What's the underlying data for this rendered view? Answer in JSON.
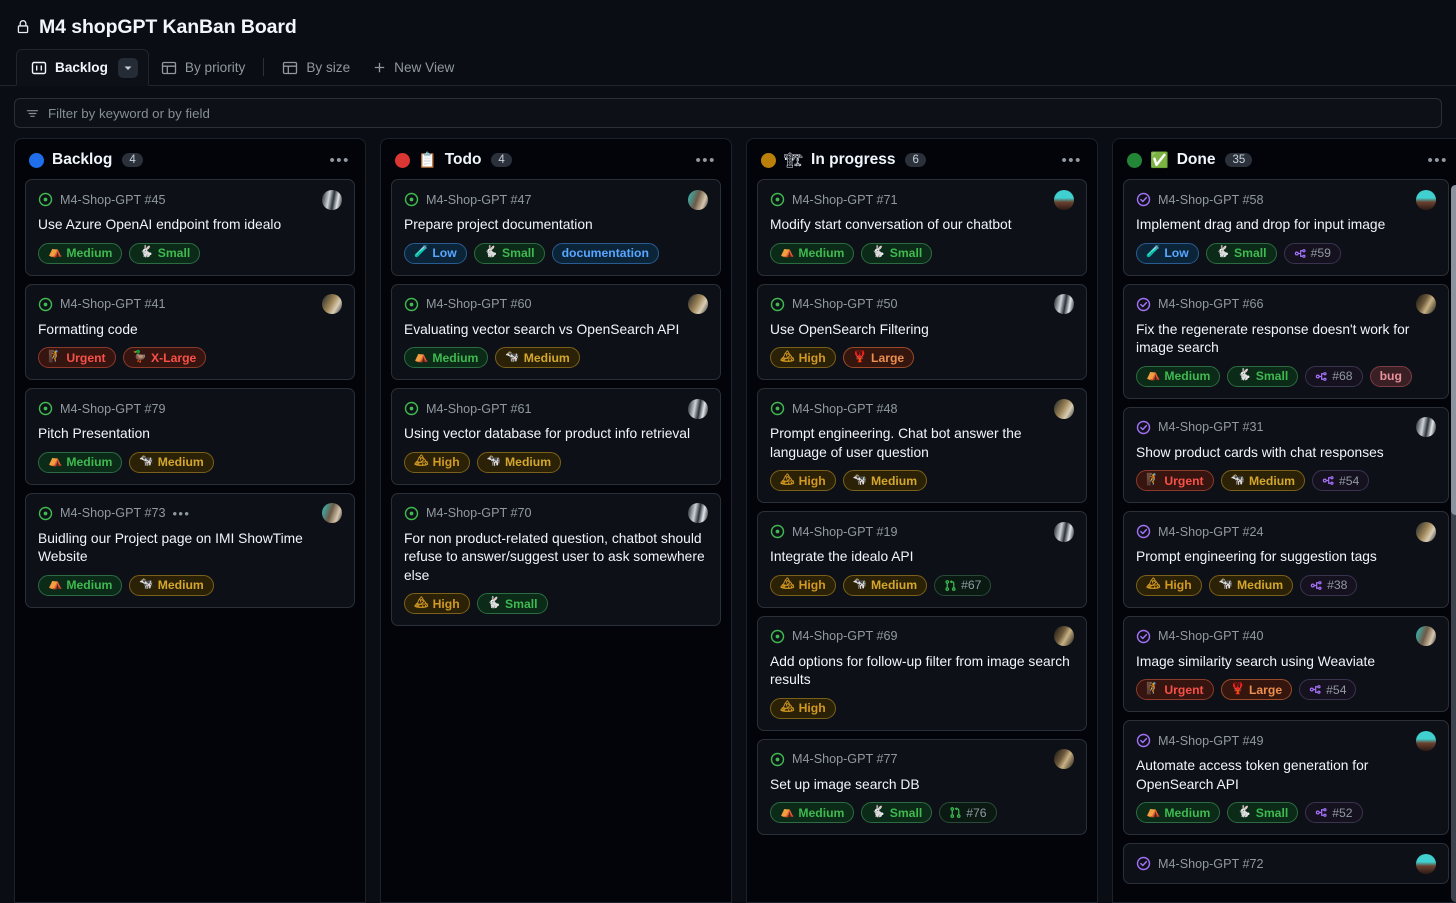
{
  "header": {
    "lock_icon": "lock-icon",
    "title": "M4 shopGPT KanBan Board"
  },
  "tabs": {
    "active": {
      "label": "Backlog",
      "icon": "board-view-icon",
      "caret_icon": "chevron-down-icon"
    },
    "items": [
      {
        "label": "By priority",
        "icon": "table-view-icon"
      },
      {
        "label": "By size",
        "icon": "table-view-icon"
      }
    ],
    "new_view": {
      "label": "New View",
      "icon": "plus-icon"
    }
  },
  "filter": {
    "icon": "filter-icon",
    "placeholder": "Filter by keyword or by field",
    "value": ""
  },
  "columns": [
    {
      "name": "Backlog",
      "dot_color": "#1f6feb",
      "emoji": "",
      "count": "4",
      "more_icon": "column-more-icon",
      "scrollbar": false,
      "cards": [
        {
          "ref": "M4-Shop-GPT #45",
          "status_icon": "open-issue-icon",
          "title": "Use Azure OpenAI endpoint from idealo",
          "avatar": "avatar-stripe",
          "inline_more": "",
          "pills": [
            {
              "emoji": "⛺",
              "text": "Medium",
              "style": "green"
            },
            {
              "emoji": "🐇",
              "text": "Small",
              "style": "green"
            }
          ]
        },
        {
          "ref": "M4-Shop-GPT #41",
          "status_icon": "open-issue-icon",
          "title": "Formatting code",
          "avatar": "avatar-gold",
          "inline_more": "",
          "pills": [
            {
              "emoji": "🧗",
              "text": "Urgent",
              "style": "red"
            },
            {
              "emoji": "🦆",
              "text": "X-Large",
              "style": "red"
            }
          ]
        },
        {
          "ref": "M4-Shop-GPT #79",
          "status_icon": "open-issue-icon",
          "title": "Pitch Presentation",
          "avatar": "",
          "inline_more": "",
          "pills": [
            {
              "emoji": "⛺",
              "text": "Medium",
              "style": "green"
            },
            {
              "emoji": "🐄",
              "text": "Medium",
              "style": "gold"
            }
          ]
        },
        {
          "ref": "M4-Shop-GPT #73",
          "status_icon": "open-issue-icon",
          "title": "Buidling our Project page on IMI ShowTime Website",
          "avatar": "avatar-teal",
          "inline_more": "•••",
          "pills": [
            {
              "emoji": "⛺",
              "text": "Medium",
              "style": "green"
            },
            {
              "emoji": "🐄",
              "text": "Medium",
              "style": "gold"
            }
          ]
        }
      ]
    },
    {
      "name": "Todo",
      "dot_color": "#da3633",
      "emoji": "📋",
      "count": "4",
      "more_icon": "column-more-icon",
      "scrollbar": false,
      "cards": [
        {
          "ref": "M4-Shop-GPT #47",
          "status_icon": "open-issue-icon",
          "title": "Prepare project documentation",
          "avatar": "avatar-teal",
          "inline_more": "",
          "pills": [
            {
              "emoji": "🧪",
              "text": "Low",
              "style": "blue"
            },
            {
              "emoji": "🐇",
              "text": "Small",
              "style": "green"
            },
            {
              "emoji": "",
              "text": "documentation",
              "style": "doc"
            }
          ]
        },
        {
          "ref": "M4-Shop-GPT #60",
          "status_icon": "open-issue-icon",
          "title": "Evaluating vector search vs OpenSearch API",
          "avatar": "avatar-gold",
          "inline_more": "",
          "pills": [
            {
              "emoji": "⛺",
              "text": "Medium",
              "style": "green"
            },
            {
              "emoji": "🐄",
              "text": "Medium",
              "style": "gold"
            }
          ]
        },
        {
          "ref": "M4-Shop-GPT #61",
          "status_icon": "open-issue-icon",
          "title": "Using vector database for product info retrieval",
          "avatar": "avatar-stripe",
          "inline_more": "",
          "pills": [
            {
              "emoji": "🏔",
              "text": "High",
              "style": "yellow"
            },
            {
              "emoji": "🐄",
              "text": "Medium",
              "style": "gold"
            }
          ]
        },
        {
          "ref": "M4-Shop-GPT #70",
          "status_icon": "open-issue-icon",
          "title": "For non product-related question, chatbot should refuse to answer/suggest user to ask somewhere else",
          "avatar": "avatar-stripe",
          "inline_more": "",
          "pills": [
            {
              "emoji": "🏔",
              "text": "High",
              "style": "yellow"
            },
            {
              "emoji": "🐇",
              "text": "Small",
              "style": "green"
            }
          ]
        }
      ]
    },
    {
      "name": "In progress",
      "dot_color": "#bb8009",
      "emoji": "🏗",
      "count": "6",
      "more_icon": "column-more-icon",
      "scrollbar": false,
      "cards": [
        {
          "ref": "M4-Shop-GPT #71",
          "status_icon": "open-issue-icon",
          "title": "Modify start conversation of our chatbot",
          "avatar": "avatar-teal2",
          "inline_more": "",
          "pills": [
            {
              "emoji": "⛺",
              "text": "Medium",
              "style": "green"
            },
            {
              "emoji": "🐇",
              "text": "Small",
              "style": "green"
            }
          ]
        },
        {
          "ref": "M4-Shop-GPT #50",
          "status_icon": "open-issue-icon",
          "title": "Use OpenSearch Filtering",
          "avatar": "avatar-stripe",
          "inline_more": "",
          "pills": [
            {
              "emoji": "🏔",
              "text": "High",
              "style": "yellow"
            },
            {
              "emoji": "🦞",
              "text": "Large",
              "style": "orange"
            }
          ]
        },
        {
          "ref": "M4-Shop-GPT #48",
          "status_icon": "open-issue-icon",
          "title": "Prompt engineering. Chat bot answer the language of user question",
          "avatar": "avatar-gold",
          "inline_more": "",
          "pills": [
            {
              "emoji": "🏔",
              "text": "High",
              "style": "yellow"
            },
            {
              "emoji": "🐄",
              "text": "Medium",
              "style": "gold"
            }
          ]
        },
        {
          "ref": "M4-Shop-GPT #19",
          "status_icon": "open-issue-icon",
          "title": "Integrate the idealo API",
          "avatar": "avatar-stripe",
          "inline_more": "",
          "pills": [
            {
              "emoji": "🏔",
              "text": "High",
              "style": "yellow"
            },
            {
              "emoji": "🐄",
              "text": "Medium",
              "style": "gold"
            },
            {
              "emoji": "",
              "text": "#67",
              "style": "greenlink",
              "icon": "pull-request-icon"
            }
          ]
        },
        {
          "ref": "M4-Shop-GPT #69",
          "status_icon": "open-issue-icon",
          "title": "Add options for follow-up filter from image search results",
          "avatar": "avatar-dark",
          "inline_more": "",
          "pills": [
            {
              "emoji": "🏔",
              "text": "High",
              "style": "yellow"
            }
          ]
        },
        {
          "ref": "M4-Shop-GPT #77",
          "status_icon": "open-issue-icon",
          "title": "Set up image search DB",
          "avatar": "avatar-dark",
          "inline_more": "",
          "pills": [
            {
              "emoji": "⛺",
              "text": "Medium",
              "style": "green"
            },
            {
              "emoji": "🐇",
              "text": "Small",
              "style": "green"
            },
            {
              "emoji": "",
              "text": "#76",
              "style": "greenlink",
              "icon": "pull-request-icon"
            }
          ]
        }
      ]
    },
    {
      "name": "Done",
      "dot_color": "#238636",
      "emoji": "✅",
      "count": "35",
      "more_icon": "column-more-icon",
      "scrollbar": true,
      "cards": [
        {
          "ref": "M4-Shop-GPT #58",
          "status_icon": "closed-issue-icon",
          "title": "Implement drag and drop for input image",
          "avatar": "avatar-teal2",
          "inline_more": "",
          "pills": [
            {
              "emoji": "🧪",
              "text": "Low",
              "style": "blue"
            },
            {
              "emoji": "🐇",
              "text": "Small",
              "style": "green"
            },
            {
              "emoji": "",
              "text": "#59",
              "style": "purplelink",
              "icon": "sub-issue-icon"
            }
          ]
        },
        {
          "ref": "M4-Shop-GPT #66",
          "status_icon": "closed-issue-icon",
          "title": "Fix the regenerate response doesn't work for image search",
          "avatar": "avatar-dark",
          "inline_more": "",
          "pills": [
            {
              "emoji": "⛺",
              "text": "Medium",
              "style": "green"
            },
            {
              "emoji": "🐇",
              "text": "Small",
              "style": "green"
            },
            {
              "emoji": "",
              "text": "#68",
              "style": "purplelink",
              "icon": "sub-issue-icon"
            },
            {
              "emoji": "",
              "text": "bug",
              "style": "bug"
            }
          ]
        },
        {
          "ref": "M4-Shop-GPT #31",
          "status_icon": "closed-issue-icon",
          "title": "Show product cards with chat responses",
          "avatar": "avatar-stripe",
          "inline_more": "",
          "pills": [
            {
              "emoji": "🧗",
              "text": "Urgent",
              "style": "red"
            },
            {
              "emoji": "🐄",
              "text": "Medium",
              "style": "gold"
            },
            {
              "emoji": "",
              "text": "#54",
              "style": "purplelink",
              "icon": "sub-issue-icon"
            }
          ]
        },
        {
          "ref": "M4-Shop-GPT #24",
          "status_icon": "closed-issue-icon",
          "title": "Prompt engineering for suggestion tags",
          "avatar": "avatar-gold",
          "inline_more": "",
          "pills": [
            {
              "emoji": "🏔",
              "text": "High",
              "style": "yellow"
            },
            {
              "emoji": "🐄",
              "text": "Medium",
              "style": "gold"
            },
            {
              "emoji": "",
              "text": "#38",
              "style": "purplelink",
              "icon": "sub-issue-icon"
            }
          ]
        },
        {
          "ref": "M4-Shop-GPT #40",
          "status_icon": "closed-issue-icon",
          "title": "Image similarity search using Weaviate",
          "avatar": "avatar-teal",
          "inline_more": "",
          "pills": [
            {
              "emoji": "🧗",
              "text": "Urgent",
              "style": "red"
            },
            {
              "emoji": "🦞",
              "text": "Large",
              "style": "orange"
            },
            {
              "emoji": "",
              "text": "#54",
              "style": "purplelink",
              "icon": "sub-issue-icon"
            }
          ]
        },
        {
          "ref": "M4-Shop-GPT #49",
          "status_icon": "closed-issue-icon",
          "title": "Automate access token generation for OpenSearch API",
          "avatar": "avatar-teal2",
          "inline_more": "",
          "pills": [
            {
              "emoji": "⛺",
              "text": "Medium",
              "style": "green"
            },
            {
              "emoji": "🐇",
              "text": "Small",
              "style": "green"
            },
            {
              "emoji": "",
              "text": "#52",
              "style": "purplelink",
              "icon": "sub-issue-icon"
            }
          ]
        },
        {
          "ref": "M4-Shop-GPT #72",
          "status_icon": "closed-issue-icon",
          "title": "",
          "avatar": "avatar-teal2",
          "inline_more": "",
          "pills": []
        }
      ]
    }
  ]
}
